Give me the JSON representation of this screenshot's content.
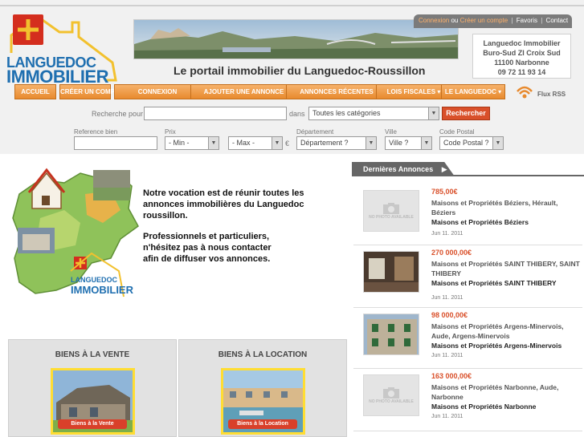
{
  "brand": {
    "line1": "LANGUEDOC",
    "line2": "IMMOBILIER"
  },
  "tagline": "Le portail immobilier du Languedoc-Roussillon",
  "account_bar": {
    "login": "Connexion",
    "or": "ou",
    "signup": "Créer un compte",
    "sep": "|",
    "favorites": "Favoris",
    "contact": "Contact"
  },
  "contact_box": {
    "line1": "Languedoc Immobilier",
    "line2": "Buro-Sud ZI Croix Sud",
    "line3": "11100 Narbonne",
    "line4": "09 72 11 93 14"
  },
  "nav": [
    {
      "label": "ACCUEIL"
    },
    {
      "label": "CRÉER UN COMPTE"
    },
    {
      "label": "CONNEXION"
    },
    {
      "label": "AJOUTER UNE ANNONCE"
    },
    {
      "label": "ANNONCES RÉCENTES"
    },
    {
      "label": "LOIS FISCALES"
    },
    {
      "label": "LE LANGUEDOC"
    }
  ],
  "rss_label": "Flux RSS",
  "search": {
    "prefix": "Recherche pour",
    "in_label": "dans",
    "category": "Toutes les catégories",
    "button": "Rechercher",
    "ref_label": "Reference bien",
    "price_label": "Prix",
    "min": "- Min -",
    "max": "- Max -",
    "currency": "€",
    "dept_label": "Département",
    "dept_value": "Département ?",
    "city_label": "Ville",
    "city_value": "Ville ?",
    "zip_label": "Code Postal",
    "zip_value": "Code Postal ?"
  },
  "map_brand": {
    "line1": "LANGUEDOC",
    "line2": "IMMOBILIER"
  },
  "intro": {
    "p1": "Notre vocation est de réunir toutes les annonces immobilières du Languedoc roussillon.",
    "p2a": "Professionnels et particuliers,",
    "p2b": "n'hésitez pas à nous contacter",
    "p2c": "afin de diffuser vos annonces."
  },
  "biens": {
    "sale_title": "BIENS À LA VENTE",
    "sale_caption": "Biens à la Vente",
    "rent_title": "BIENS À LA LOCATION",
    "rent_caption": "Biens à la Location"
  },
  "annonces": {
    "title": "Dernières Annonces",
    "nophoto": "NO PHOTO AVAILABLE",
    "items": [
      {
        "price": "785,00€",
        "desc": "Maisons et Propriétés Béziers, Hérault, Béziers",
        "cat": "Maisons et Propriétés Béziers",
        "date": "Jun 11. 2011"
      },
      {
        "price": "270 000,00€",
        "desc": "Maisons et Propriétés SAINT THIBERY, SAINT THIBERY",
        "cat": "Maisons et Propriétés SAINT THIBERY",
        "date": "Jun 11. 2011"
      },
      {
        "price": "98 000,00€",
        "desc": "Maisons et Propriétés Argens-Minervois, Aude, Argens-Minervois",
        "cat": "Maisons et Propriétés Argens-Minervois",
        "date": "Jun 11. 2011"
      },
      {
        "price": "163 000,00€",
        "desc": "Maisons et Propriétés Narbonne, Aude, Narbonne",
        "cat": "Maisons et Propriétés Narbonne",
        "date": "Jun 11. 2011"
      }
    ]
  },
  "colors": {
    "accent": "#e88a2e",
    "brand_blue": "#1f6fb0",
    "price_red": "#d9502a"
  }
}
